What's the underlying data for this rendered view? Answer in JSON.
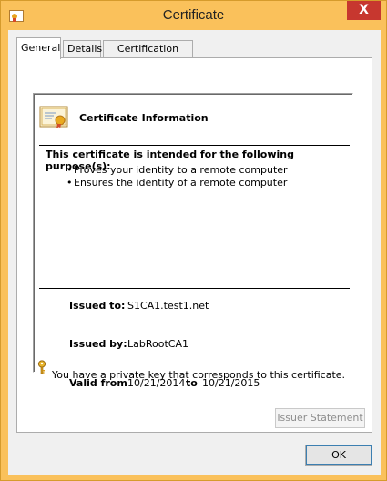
{
  "window": {
    "title": "Certificate",
    "close_symbol": "X",
    "colors": {
      "frame": "#fac15b",
      "close": "#c7372f"
    }
  },
  "tabs": [
    {
      "label": "General",
      "active": true
    },
    {
      "label": "Details",
      "active": false
    },
    {
      "label": "Certification Path",
      "active": false
    }
  ],
  "certificate": {
    "info_title": "Certificate Information",
    "purpose_heading": "This certificate is intended for the following purpose(s):",
    "purposes": [
      "Proves your identity to a remote computer",
      "Ensures the identity of a remote computer"
    ],
    "bullet": "•",
    "issued_to_label": "Issued to:",
    "issued_to": "S1CA1.test1.net",
    "issued_by_label": "Issued by:",
    "issued_by": "LabRootCA1",
    "valid_from_label": "Valid from",
    "valid_from": "10/21/2014",
    "valid_to_label": "to",
    "valid_to": "10/21/2015",
    "private_key_note": "You have a private key that corresponds to this certificate."
  },
  "buttons": {
    "issuer_statement": "Issuer Statement",
    "issuer_statement_enabled": false,
    "ok": "OK"
  },
  "icons": {
    "app": "certificate-icon",
    "info": "certificate-icon",
    "key": "key-icon"
  }
}
